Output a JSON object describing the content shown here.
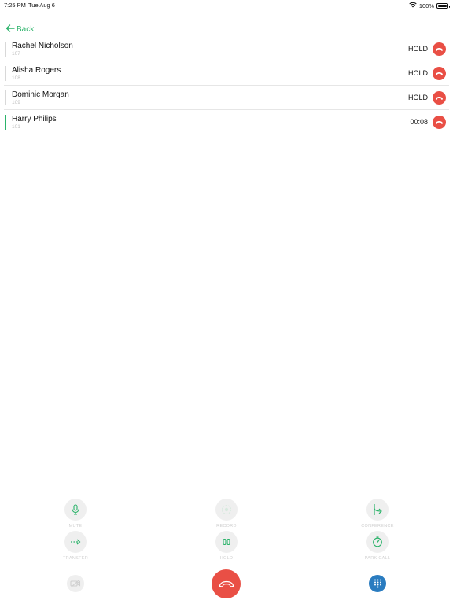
{
  "status_bar": {
    "time": "7:25 PM",
    "date": "Tue Aug 6",
    "battery": "100%"
  },
  "nav": {
    "back_label": "Back"
  },
  "calls": [
    {
      "name": "Rachel Nicholson",
      "ext": "107",
      "status": "HOLD",
      "active": false
    },
    {
      "name": "Alisha Rogers",
      "ext": "108",
      "status": "HOLD",
      "active": false
    },
    {
      "name": "Dominic Morgan",
      "ext": "109",
      "status": "HOLD",
      "active": false
    },
    {
      "name": "Harry Philips",
      "ext": "101",
      "status": "00:08",
      "active": true
    }
  ],
  "controls": {
    "mute": {
      "label": "MUTE",
      "icon": "microphone-icon"
    },
    "record": {
      "label": "RECORD",
      "icon": "record-icon"
    },
    "conference": {
      "label": "CONFERENCE",
      "icon": "merge-arrow-icon"
    },
    "transfer": {
      "label": "TRANSFER",
      "icon": "transfer-arrow-icon"
    },
    "hold": {
      "label": "HOLD",
      "icon": "pause-icon"
    },
    "park": {
      "label": "PARK CALL",
      "icon": "timer-icon"
    }
  },
  "colors": {
    "accent": "#2bb36a",
    "hangup": "#e94f45",
    "keypad": "#2a7cc0",
    "control_bg": "#efefef"
  }
}
